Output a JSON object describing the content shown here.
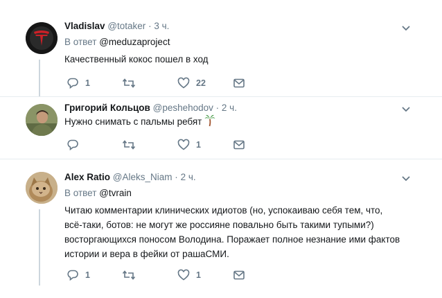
{
  "tweets": [
    {
      "name": "Vladislav",
      "handle": "@totaker",
      "time": "3 ч.",
      "reply_prefix": "В ответ",
      "reply_to": "@meduzaproject",
      "lines": [
        "Качественный кокос пошел в ход"
      ],
      "reply_count": "1",
      "retweet_count": "",
      "like_count": "22"
    },
    {
      "name": "Григорий Кольцов",
      "handle": "@peshehodov",
      "time": "2 ч.",
      "lines": [
        "Нужно снимать с пальмы ребят"
      ],
      "emoji": "palm-tree-icon",
      "reply_count": "",
      "retweet_count": "",
      "like_count": "1"
    },
    {
      "name": "Alex Ratio",
      "handle": "@Aleks_Niam",
      "time": "2 ч.",
      "reply_prefix": "В ответ",
      "reply_to": "@tvrain",
      "lines": [
        "Читаю комментарии клинических идиотов (но, успокаиваю себя тем, что,",
        "всё-таки, ботов: не могут же россияне повально быть такими тупыми?)",
        "восторгающихся поносом Володина. Поражает полное незнание ими фактов",
        "истории и вера в фейки от рашаСМИ."
      ],
      "reply_count": "1",
      "retweet_count": "",
      "like_count": "1"
    }
  ],
  "separator": "·",
  "colors": {
    "secondary": "#657786",
    "border": "#e6ecf0",
    "thread": "#ccd6dd",
    "tesla_red": "#cc2027"
  }
}
